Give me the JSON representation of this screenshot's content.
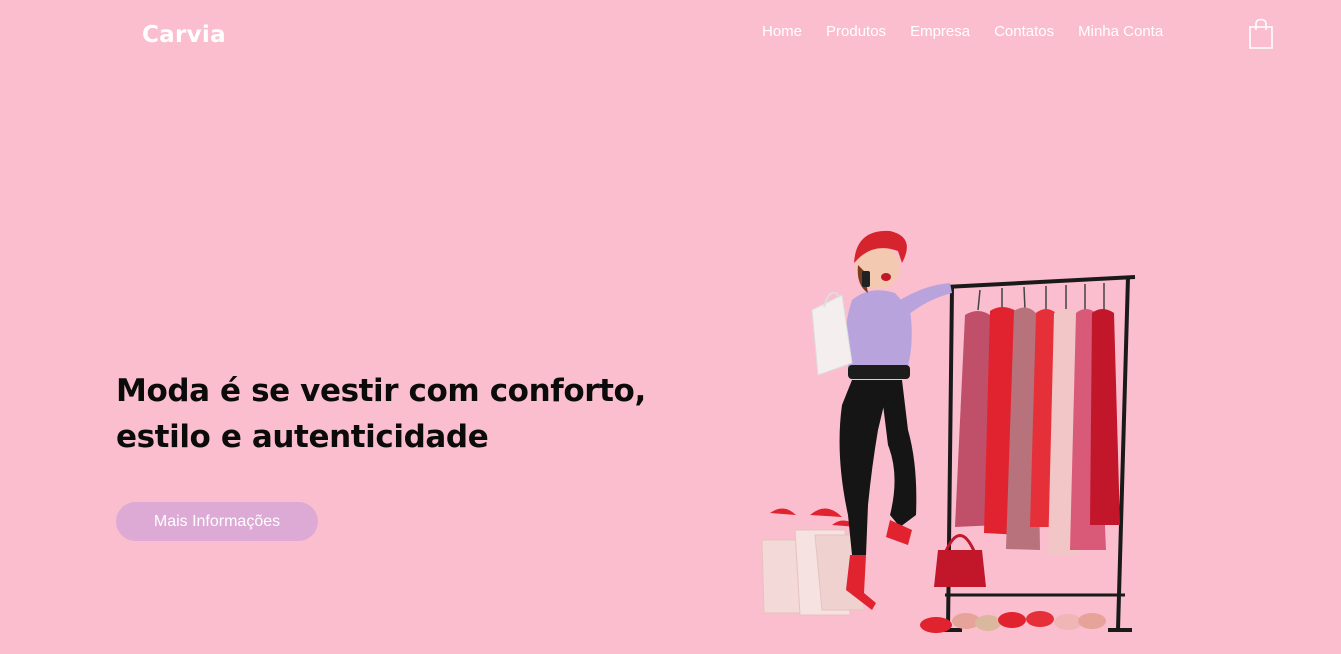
{
  "brand": {
    "name": "Carvia"
  },
  "nav": {
    "items": [
      {
        "label": "Home"
      },
      {
        "label": "Produtos"
      },
      {
        "label": "Empresa"
      },
      {
        "label": "Contatos"
      },
      {
        "label": "Minha Conta"
      }
    ],
    "cart_icon": "shopping-bag-icon"
  },
  "hero": {
    "title_line1": "Moda é se vestir com conforto,",
    "title_line2": "estilo e autenticidade",
    "cta_label": "Mais Informações"
  },
  "colors": {
    "background": "#fabecf",
    "button": "#dcaad4",
    "text_dark": "#0b0b0b",
    "nav_text": "#ffffff"
  }
}
